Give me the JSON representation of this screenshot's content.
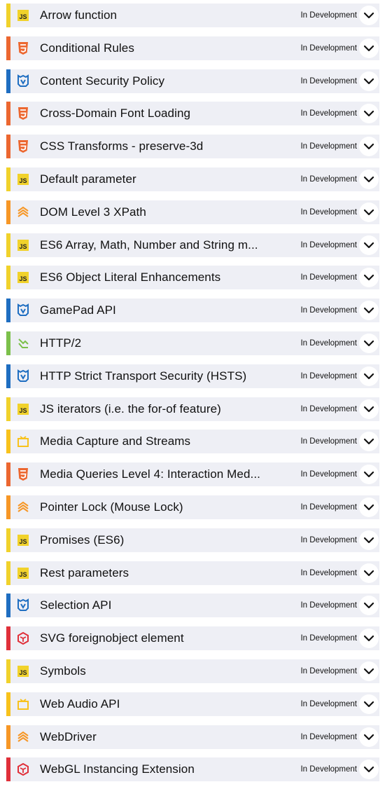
{
  "status_label": "In Development",
  "category_colors": {
    "js": "#f1d22b",
    "html5": "#ec6730",
    "w3c": "#1f6ec1",
    "dom": "#f79726",
    "network": "#7cc04b",
    "media": "#f8c21c",
    "svg": "#e0303a"
  },
  "features": [
    {
      "name": "Arrow function",
      "category": "js",
      "icon": "js-icon"
    },
    {
      "name": "Conditional Rules",
      "category": "html5",
      "icon": "html5-shield-icon"
    },
    {
      "name": "Content Security Policy",
      "category": "w3c",
      "icon": "shield-lock-icon"
    },
    {
      "name": "Cross-Domain Font Loading",
      "category": "html5",
      "icon": "html5-shield-icon"
    },
    {
      "name": "CSS Transforms - preserve-3d",
      "category": "html5",
      "icon": "html5-shield-icon"
    },
    {
      "name": "Default parameter",
      "category": "js",
      "icon": "js-icon"
    },
    {
      "name": "DOM Level 3 XPath",
      "category": "dom",
      "icon": "layers-icon"
    },
    {
      "name": "ES6 Array, Math, Number and String m...",
      "category": "js",
      "icon": "js-icon"
    },
    {
      "name": "ES6 Object Literal Enhancements",
      "category": "js",
      "icon": "js-icon"
    },
    {
      "name": "GamePad API",
      "category": "w3c",
      "icon": "shield-lock-icon"
    },
    {
      "name": "HTTP/2",
      "category": "network",
      "icon": "network-icon"
    },
    {
      "name": "HTTP Strict Transport Security (HSTS)",
      "category": "w3c",
      "icon": "shield-lock-icon"
    },
    {
      "name": "JS iterators (i.e. the for-of feature)",
      "category": "js",
      "icon": "js-icon"
    },
    {
      "name": "Media Capture and Streams",
      "category": "media",
      "icon": "media-frame-icon"
    },
    {
      "name": "Media Queries Level 4: Interaction Med...",
      "category": "html5",
      "icon": "html5-shield-icon"
    },
    {
      "name": "Pointer Lock (Mouse Lock)",
      "category": "dom",
      "icon": "layers-icon"
    },
    {
      "name": "Promises (ES6)",
      "category": "js",
      "icon": "js-icon"
    },
    {
      "name": "Rest parameters",
      "category": "js",
      "icon": "js-icon"
    },
    {
      "name": "Selection API",
      "category": "w3c",
      "icon": "shield-lock-icon"
    },
    {
      "name": "SVG foreignobject element",
      "category": "svg",
      "icon": "svg-cube-icon"
    },
    {
      "name": "Symbols",
      "category": "js",
      "icon": "js-icon"
    },
    {
      "name": "Web Audio API",
      "category": "media",
      "icon": "media-frame-icon"
    },
    {
      "name": "WebDriver",
      "category": "dom",
      "icon": "layers-icon"
    },
    {
      "name": "WebGL Instancing Extension",
      "category": "svg",
      "icon": "svg-cube-icon"
    }
  ]
}
